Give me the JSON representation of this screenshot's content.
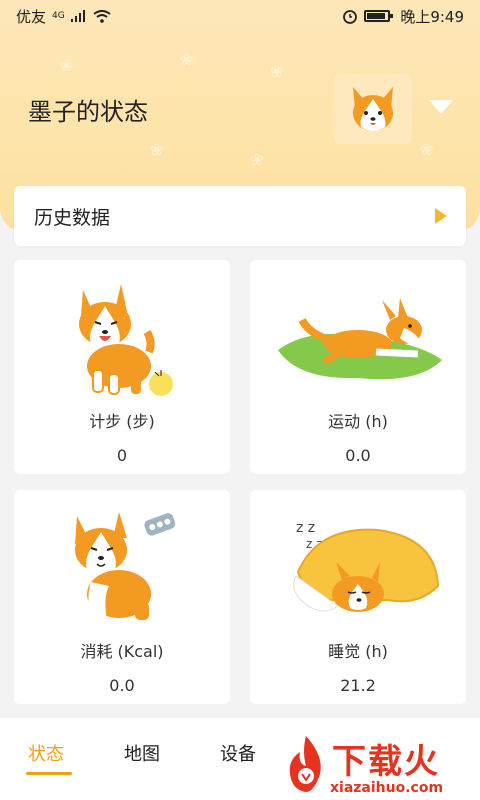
{
  "status_bar": {
    "carrier": "优友",
    "signal": "4G",
    "time": "晚上9:49"
  },
  "header": {
    "title": "墨子的状态"
  },
  "history": {
    "label": "历史数据"
  },
  "cards": [
    {
      "label": "计步 (步)",
      "value": "0",
      "icon": "corgi-standing"
    },
    {
      "label": "运动 (h)",
      "value": "0.0",
      "icon": "corgi-running"
    },
    {
      "label": "消耗 (Kcal)",
      "value": "0.0",
      "icon": "corgi-sitting"
    },
    {
      "label": "睡觉 (h)",
      "value": "21.2",
      "icon": "corgi-sleeping"
    }
  ],
  "tabs": [
    {
      "label": "状态",
      "active": true
    },
    {
      "label": "地图",
      "active": false
    },
    {
      "label": "设备",
      "active": false
    }
  ],
  "watermark": {
    "text": "下载火",
    "sub": "xiazaihuo.com"
  },
  "colors": {
    "accent": "#f0a10e",
    "header": "#fde3a6",
    "watermark": "#e5331f"
  }
}
